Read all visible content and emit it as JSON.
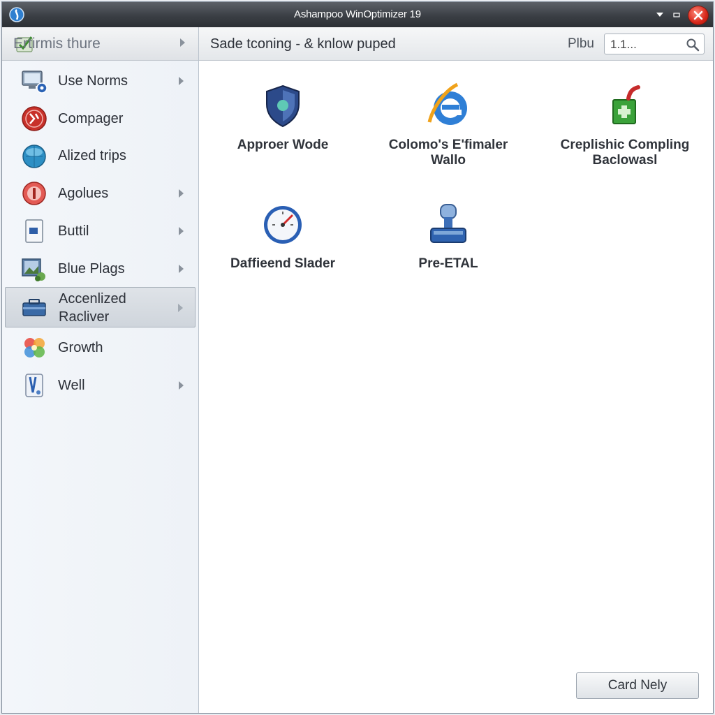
{
  "window": {
    "title": "Ashampoo WinOptimizer 19"
  },
  "sidebar": {
    "header_label": "Ertirmis thure",
    "items": [
      {
        "label": "Use Norms",
        "has_arrow": true,
        "icon": "monitor-icon"
      },
      {
        "label": "Compager",
        "has_arrow": false,
        "icon": "red-badge-icon"
      },
      {
        "label": "Alized trips",
        "has_arrow": false,
        "icon": "globe-icon"
      },
      {
        "label": "Agolues",
        "has_arrow": true,
        "icon": "red-circle-icon"
      },
      {
        "label": "Buttil",
        "has_arrow": true,
        "icon": "document-icon"
      },
      {
        "label": "Blue Plags",
        "has_arrow": true,
        "icon": "picture-icon"
      },
      {
        "label_line1": "Accenlized",
        "label_line2": "Racliver",
        "has_arrow": true,
        "selected": true,
        "icon": "toolbox-icon"
      },
      {
        "label": "Growth",
        "has_arrow": false,
        "icon": "flower-icon"
      },
      {
        "label": "Well",
        "has_arrow": true,
        "icon": "pen-icon"
      }
    ]
  },
  "main": {
    "heading": "Sade tconing - & knlow puped",
    "search_label": "Plbu",
    "search_value": "1.1...",
    "tiles": [
      {
        "label_line1": "Approer Wode",
        "label_line2": "",
        "icon": "shield-icon"
      },
      {
        "label_line1": "Colomo's E'fimaler",
        "label_line2": "Wallo",
        "icon": "browser-e-icon"
      },
      {
        "label_line1": "Creplishic Compling",
        "label_line2": "Baclowasl",
        "icon": "package-icon"
      },
      {
        "label_line1": "Daffieend Slader",
        "label_line2": "",
        "icon": "gauge-icon"
      },
      {
        "label_line1": "Pre-ETAL",
        "label_line2": "",
        "icon": "usb-drive-icon"
      }
    ],
    "footer_button": "Card Nely"
  },
  "colors": {
    "title_bar": "#3b3f45",
    "close_button": "#d7271a",
    "selection": "#cfd5dc",
    "sidebar_bg": "#f0f4f8"
  }
}
